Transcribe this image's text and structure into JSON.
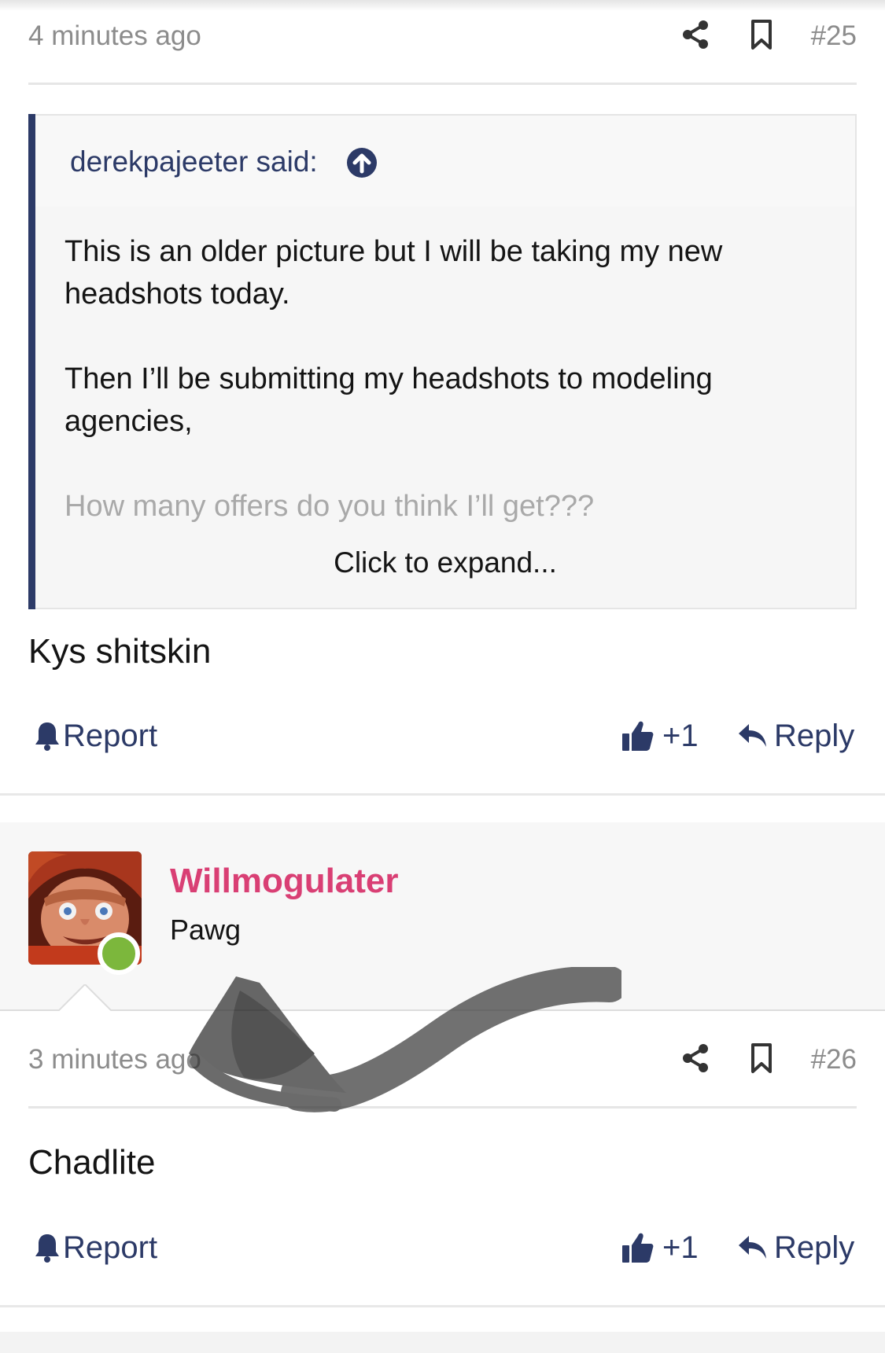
{
  "post25": {
    "time": "4 minutes ago",
    "number": "#25",
    "quote": {
      "author": "derekpajeeter said:",
      "lines": [
        "This is an older picture but I will be taking my new",
        "headshots today.",
        "Then I’ll be submitting my headshots to modeling",
        "agencies,",
        "How many offers do you think I’ll get???"
      ],
      "expand": "Click to expand..."
    },
    "body": "Kys shitskin",
    "actions": {
      "report": "Report",
      "like": "+1",
      "reply": "Reply"
    }
  },
  "post26": {
    "user": {
      "name": "Willmogulater",
      "title": "Pawg",
      "online": true
    },
    "time": "3 minutes ago",
    "number": "#26",
    "body": "Chadlite",
    "actions": {
      "report": "Report",
      "like": "+1",
      "reply": "Reply"
    }
  },
  "colors": {
    "accent": "#2c3a67",
    "username": "#d93f74",
    "muted": "#8c8c8c",
    "online": "#7cb73c"
  },
  "icons": [
    "share-icon",
    "bookmark-icon",
    "arrow-up-circle-icon",
    "bell-icon",
    "thumbs-up-icon",
    "reply-icon"
  ]
}
